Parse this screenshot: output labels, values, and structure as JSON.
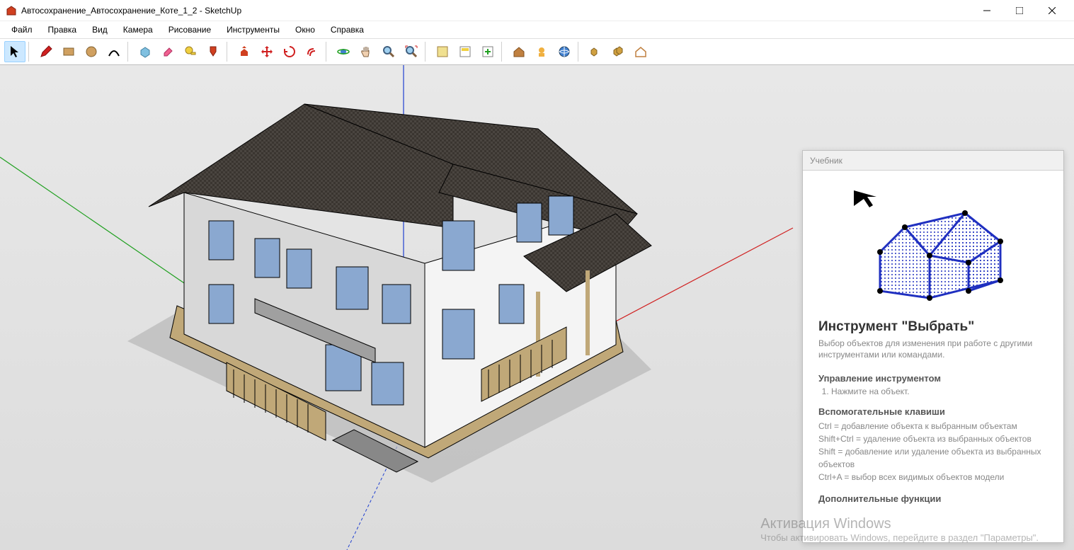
{
  "window": {
    "title": "Автосохранение_Автосохранение_Коте_1_2 - SketchUp"
  },
  "menu": {
    "items": [
      "Файл",
      "Правка",
      "Вид",
      "Камера",
      "Рисование",
      "Инструменты",
      "Окно",
      "Справка"
    ]
  },
  "toolbar": {
    "groups": [
      [
        {
          "name": "select",
          "title": "Выбрать"
        }
      ],
      [
        {
          "name": "pencil",
          "title": "Линия"
        },
        {
          "name": "rectangle",
          "title": "Прямоугольник"
        },
        {
          "name": "circle",
          "title": "Круг"
        },
        {
          "name": "arc",
          "title": "Дуга"
        }
      ],
      [
        {
          "name": "make-component",
          "title": "Создать компонент"
        },
        {
          "name": "eraser",
          "title": "Ластик"
        },
        {
          "name": "tape",
          "title": "Рулетка"
        },
        {
          "name": "paint",
          "title": "Заливка"
        }
      ],
      [
        {
          "name": "push-pull",
          "title": "Тяни/Толкай"
        },
        {
          "name": "move",
          "title": "Переместить"
        },
        {
          "name": "rotate",
          "title": "Повернуть"
        },
        {
          "name": "offset",
          "title": "Смещение"
        }
      ],
      [
        {
          "name": "orbit",
          "title": "Орбита"
        },
        {
          "name": "pan",
          "title": "Панорама"
        },
        {
          "name": "zoom",
          "title": "Масштаб"
        },
        {
          "name": "zoom-extents",
          "title": "Показать всё"
        }
      ],
      [
        {
          "name": "add-location",
          "title": "Добавить местоположение"
        },
        {
          "name": "get-models",
          "title": "Получить модели"
        },
        {
          "name": "share",
          "title": "Поделиться"
        }
      ],
      [
        {
          "name": "extension-warehouse",
          "title": "Склад расширений"
        },
        {
          "name": "layout",
          "title": "LayOut"
        },
        {
          "name": "3d-warehouse",
          "title": "3D Warehouse"
        }
      ],
      [
        {
          "name": "solid-union",
          "title": "Объединение"
        },
        {
          "name": "solid-subtract",
          "title": "Вычитание"
        },
        {
          "name": "solid-trim",
          "title": "Обрезка"
        }
      ]
    ]
  },
  "instructor": {
    "header": "Учебник",
    "title": "Инструмент \"Выбрать\"",
    "description": "Выбор объектов для изменения при работе с другими инструментами или командами.",
    "section1_title": "Управление инструментом",
    "steps": [
      "Нажмите на объект."
    ],
    "section2_title": "Вспомогательные клавиши",
    "keys": [
      "Ctrl = добавление объекта к выбранным объектам",
      "Shift+Ctrl = удаление объекта из выбранных объектов",
      "Shift = добавление или удаление объекта из выбранных объектов",
      "Ctrl+A = выбор всех видимых объектов модели"
    ],
    "section3_title": "Дополнительные функции"
  },
  "watermark": {
    "title": "Активация Windows",
    "sub": "Чтобы активировать Windows, перейдите в раздел \"Параметры\"."
  }
}
